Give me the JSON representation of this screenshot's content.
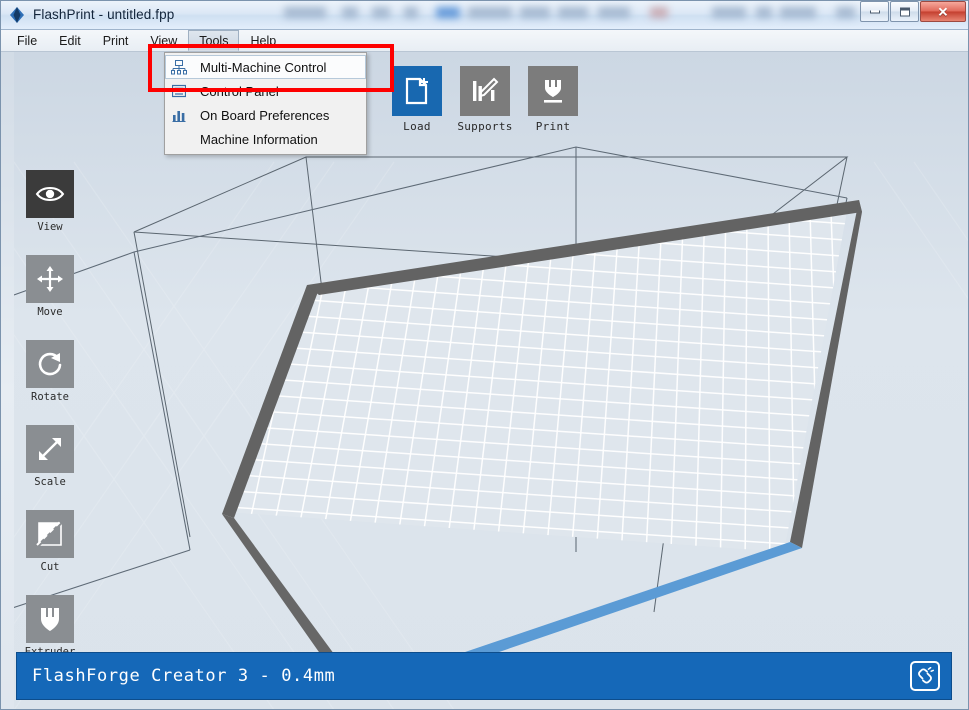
{
  "window": {
    "title": "FlashPrint - untitled.fpp",
    "logo_icon": "flashprint-diamond-icon",
    "minimize_label": "",
    "maximize_label": "",
    "close_label": "✕"
  },
  "menubar": {
    "items": [
      {
        "label": "File",
        "active": false
      },
      {
        "label": "Edit",
        "active": false
      },
      {
        "label": "Print",
        "active": false
      },
      {
        "label": "View",
        "active": false
      },
      {
        "label": "Tools",
        "active": true
      },
      {
        "label": "Help",
        "active": false
      }
    ]
  },
  "tools_menu": {
    "items": [
      {
        "label": "Multi-Machine Control",
        "icon": "multi-machine-network-icon",
        "selected": true
      },
      {
        "label": "Control Panel",
        "icon": "control-panel-icon",
        "selected": false
      },
      {
        "label": "On Board Preferences",
        "icon": "bar-chart-icon",
        "selected": false
      },
      {
        "label": "Machine Information",
        "icon": "none",
        "selected": false
      }
    ]
  },
  "annotation": {
    "highlight_color": "#fe0000"
  },
  "toolbar_top": {
    "items": [
      {
        "label": "Load",
        "icon": "load-file-plus-icon",
        "style": "blue"
      },
      {
        "label": "Supports",
        "icon": "supports-pencil-icon",
        "style": "gray"
      },
      {
        "label": "Print",
        "icon": "print-extruder-icon",
        "style": "gray"
      }
    ]
  },
  "toolbar_left": {
    "items": [
      {
        "label": "View",
        "icon": "eye-icon",
        "active": true
      },
      {
        "label": "Move",
        "icon": "move-arrows-icon",
        "active": false
      },
      {
        "label": "Rotate",
        "icon": "rotate-arrow-icon",
        "active": false
      },
      {
        "label": "Scale",
        "icon": "scale-diagonal-arrow-icon",
        "active": false
      },
      {
        "label": "Cut",
        "icon": "cut-plane-icon",
        "active": false
      },
      {
        "label": "Extruder",
        "icon": "extruder-icon",
        "active": false
      }
    ]
  },
  "statusbar": {
    "machine_text": "FlashForge Creator 3 - 0.4mm",
    "connection_icon": "machine-connect-icon",
    "background_color": "#1568b8"
  },
  "viewport": {
    "build_plate": {
      "border_color": "#636363",
      "front_edge_color": "#5b9bd5",
      "grid_color": "#ffffff"
    },
    "axes": {
      "x_color": "#d81414",
      "y_color": "#12b012",
      "z_color": "#1b1bd8"
    },
    "wireframe_color": "#5b6670"
  }
}
